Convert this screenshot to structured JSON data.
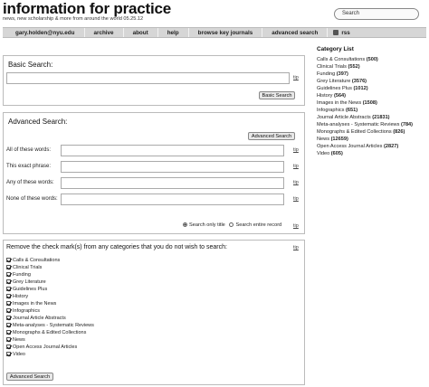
{
  "header": {
    "logo": "information for practice",
    "tagline": "news, new scholarship & more from around the world 05.25.12",
    "search_label": "Search"
  },
  "nav": [
    {
      "label": "gary.holden@nyu.edu"
    },
    {
      "label": "archive"
    },
    {
      "label": "about"
    },
    {
      "label": "help"
    },
    {
      "label": "browse key journals"
    },
    {
      "label": "advanced search"
    },
    {
      "label": "rss"
    }
  ],
  "basic": {
    "title": "Basic Search:",
    "tip": "tip",
    "button": "Basic Search"
  },
  "advanced": {
    "title": "Advanced Search:",
    "button_top": "Advanced Search",
    "fields": [
      {
        "label": "All of these words:",
        "tip": "tip"
      },
      {
        "label": "This exact phrase:",
        "tip": "tip"
      },
      {
        "label": "Any of these words:",
        "tip": "tip"
      },
      {
        "label": "None of these words:",
        "tip": "tip"
      }
    ],
    "radio_title": "Search only title",
    "radio_all": "Search entire record",
    "radio_tip": "tip"
  },
  "categories": {
    "title": "Remove the check mark(s) from any categories that you do not wish to search:",
    "tip": "tip",
    "items": [
      "Calls & Consultations",
      "Clinical Trials",
      "Funding",
      "Grey Literature",
      "Guidelines Plus",
      "History",
      "Images in the News",
      "Infographics",
      "Journal Article Abstracts",
      "Meta-analyses - Systematic Reviews",
      "Monographs & Edited Collections",
      "News",
      "Open Access Journal Articles",
      "Video"
    ],
    "button": "Advanced Search"
  },
  "sidebar": {
    "title": "Category List",
    "items": [
      {
        "name": "Calls & Consultations",
        "count": "(500)"
      },
      {
        "name": "Clinical Trials",
        "count": "(552)"
      },
      {
        "name": "Funding",
        "count": "(397)"
      },
      {
        "name": "Grey Literature",
        "count": "(3576)"
      },
      {
        "name": "Guidelines Plus",
        "count": "(1012)"
      },
      {
        "name": "History",
        "count": "(564)"
      },
      {
        "name": "Images in the News",
        "count": "(1508)"
      },
      {
        "name": "Infographics",
        "count": "(651)"
      },
      {
        "name": "Journal Article Abstracts",
        "count": "(21831)"
      },
      {
        "name": "Meta-analyses - Systematic Reviews",
        "count": "(784)"
      },
      {
        "name": "Monographs & Edited Collections",
        "count": "(826)"
      },
      {
        "name": "News",
        "count": "(12659)"
      },
      {
        "name": "Open Access Journal Articles",
        "count": "(2827)"
      },
      {
        "name": "Video",
        "count": "(605)"
      }
    ]
  }
}
